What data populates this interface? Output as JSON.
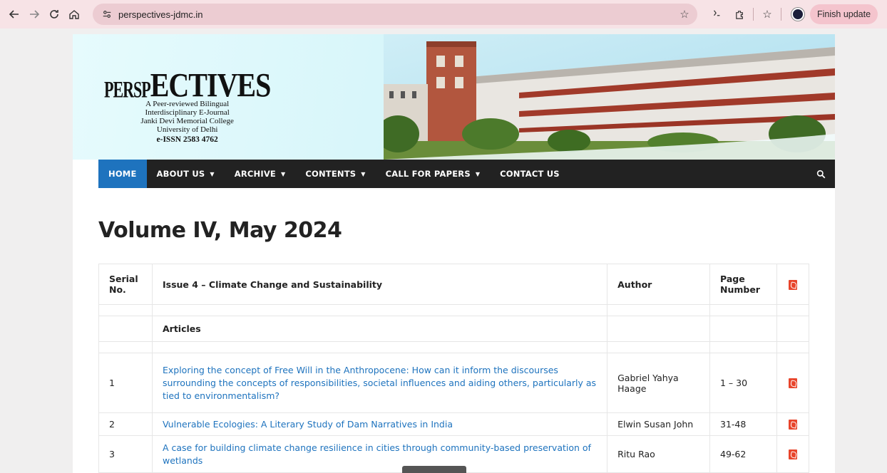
{
  "browser": {
    "url": "perspectives-jdmc.in",
    "finish_update_label": "Finish update"
  },
  "header": {
    "logo": {
      "title_small": "PERSP",
      "title_large": "ECTIVES",
      "line1": "A Peer-reviewed Bilingual",
      "line2": "Interdisciplinary E-Journal",
      "line3": "Janki Devi Memorial College",
      "line4": "University of Delhi",
      "issn": "e-ISSN 2583 4762"
    }
  },
  "nav": {
    "items": [
      {
        "label": "HOME"
      },
      {
        "label": "ABOUT US"
      },
      {
        "label": "ARCHIVE"
      },
      {
        "label": "CONTENTS"
      },
      {
        "label": "CALL FOR PAPERS"
      },
      {
        "label": "CONTACT US"
      }
    ]
  },
  "page": {
    "title": "Volume IV, May 2024"
  },
  "table": {
    "headers": {
      "serial": "Serial No.",
      "issue": "Issue 4 – Climate Change and Sustainability",
      "author": "Author",
      "page": "Page Number"
    },
    "section_label": "Articles",
    "rows": [
      {
        "serial": "1",
        "title": "Exploring the concept of Free Will in the Anthropocene: How can it inform the discourses surrounding the concepts of responsibilities, societal influences and aiding others, particularly as tied to environmentalism?",
        "author": "Gabriel Yahya Haage",
        "pages": "1 – 30"
      },
      {
        "serial": "2",
        "title": "Vulnerable Ecologies: A Literary Study of Dam Narratives in India",
        "author": "Elwin Susan John",
        "pages": "31-48"
      },
      {
        "serial": "3",
        "title": "A case for building climate change resilience in cities through community-based preservation of wetlands",
        "author": "Ritu Rao",
        "pages": "49-62"
      }
    ]
  },
  "colors": {
    "nav_active": "#1e73be",
    "navbar_bg": "#222222",
    "link": "#1e73be",
    "pdf": "#e8452c"
  }
}
